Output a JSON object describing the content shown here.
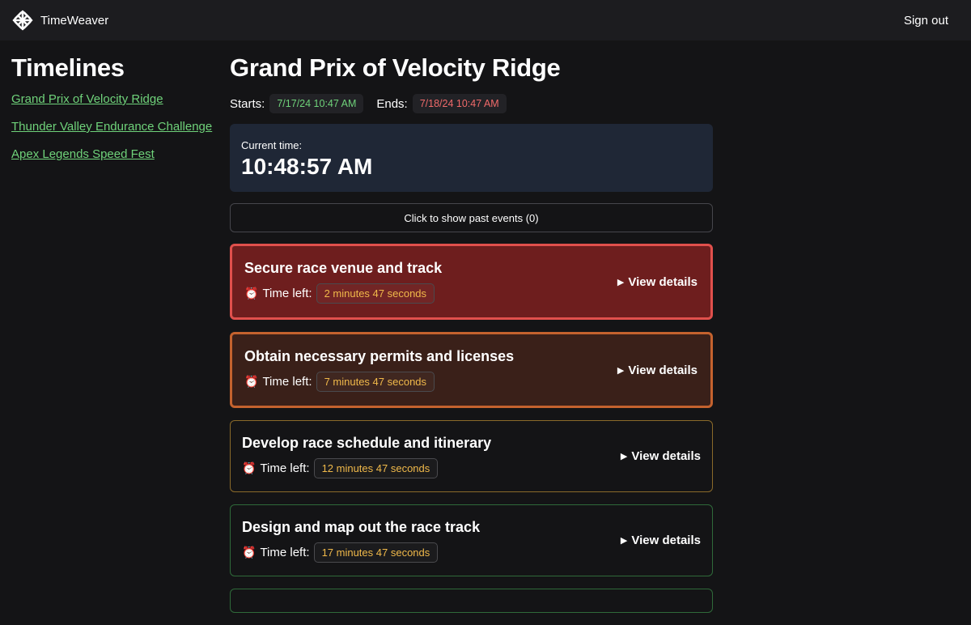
{
  "app": {
    "name": "TimeWeaver",
    "sign_out": "Sign out",
    "logo_icon": "knot-logo-icon"
  },
  "sidebar": {
    "heading": "Timelines",
    "items": [
      {
        "label": "Grand Prix of Velocity Ridge"
      },
      {
        "label": "Thunder Valley Endurance Challenge"
      },
      {
        "label": "Apex Legends Speed Fest"
      }
    ]
  },
  "main": {
    "title": "Grand Prix of Velocity Ridge",
    "starts_label": "Starts:",
    "starts_value": "7/17/24 10:47 AM",
    "ends_label": "Ends:",
    "ends_value": "7/18/24 10:47 AM",
    "current_time_label": "Current time:",
    "current_time": "10:48:57 AM",
    "past_events_button": "Click to show past events (0)",
    "time_left_label": "Time left:",
    "view_details_label": "View details",
    "events": [
      {
        "title": "Secure race venue and track",
        "time_left": "2 minutes 47 seconds",
        "status": "red"
      },
      {
        "title": "Obtain necessary permits and licenses",
        "time_left": "7 minutes 47 seconds",
        "status": "orange"
      },
      {
        "title": "Develop race schedule and itinerary",
        "time_left": "12 minutes 47 seconds",
        "status": "amber"
      },
      {
        "title": "Design and map out the race track",
        "time_left": "17 minutes 47 seconds",
        "status": "green"
      }
    ]
  },
  "colors": {
    "background": "#141416",
    "link_green": "#6fd27a",
    "end_red": "#f06a6a",
    "urgent_red": "#e0504c",
    "warn_orange": "#c4622e",
    "amber_border": "#8a6a2a",
    "ok_green": "#2f6a3a",
    "time_left_text": "#f0b94a",
    "clock_panel": "#1f2736"
  }
}
